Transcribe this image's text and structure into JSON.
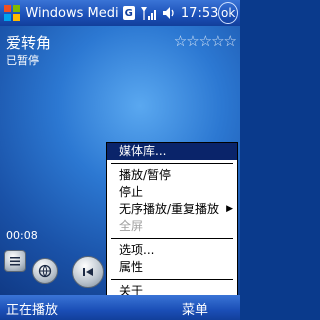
{
  "titlebar": {
    "title": "Windows Medi",
    "badge": "G",
    "time": "17:53",
    "close": "ok"
  },
  "player": {
    "song": "爱转角",
    "status": "已暂停",
    "stars": "☆☆☆☆☆",
    "elapsed": "00:08"
  },
  "menu": {
    "items": [
      {
        "label": "媒体库...",
        "selected": true
      },
      {
        "label": "播放/暂停"
      },
      {
        "label": "停止"
      },
      {
        "label": "无序播放/重复播放",
        "arrow": "▶"
      },
      {
        "label": "全屏",
        "disabled": true
      },
      {
        "label": "选项..."
      },
      {
        "label": "属性"
      },
      {
        "label": "关于"
      }
    ]
  },
  "softkeys": {
    "left": "正在播放",
    "right": "菜单"
  },
  "colors": {
    "titlebar": "#1b4fb7",
    "menu_highlight": "#0a246a"
  }
}
